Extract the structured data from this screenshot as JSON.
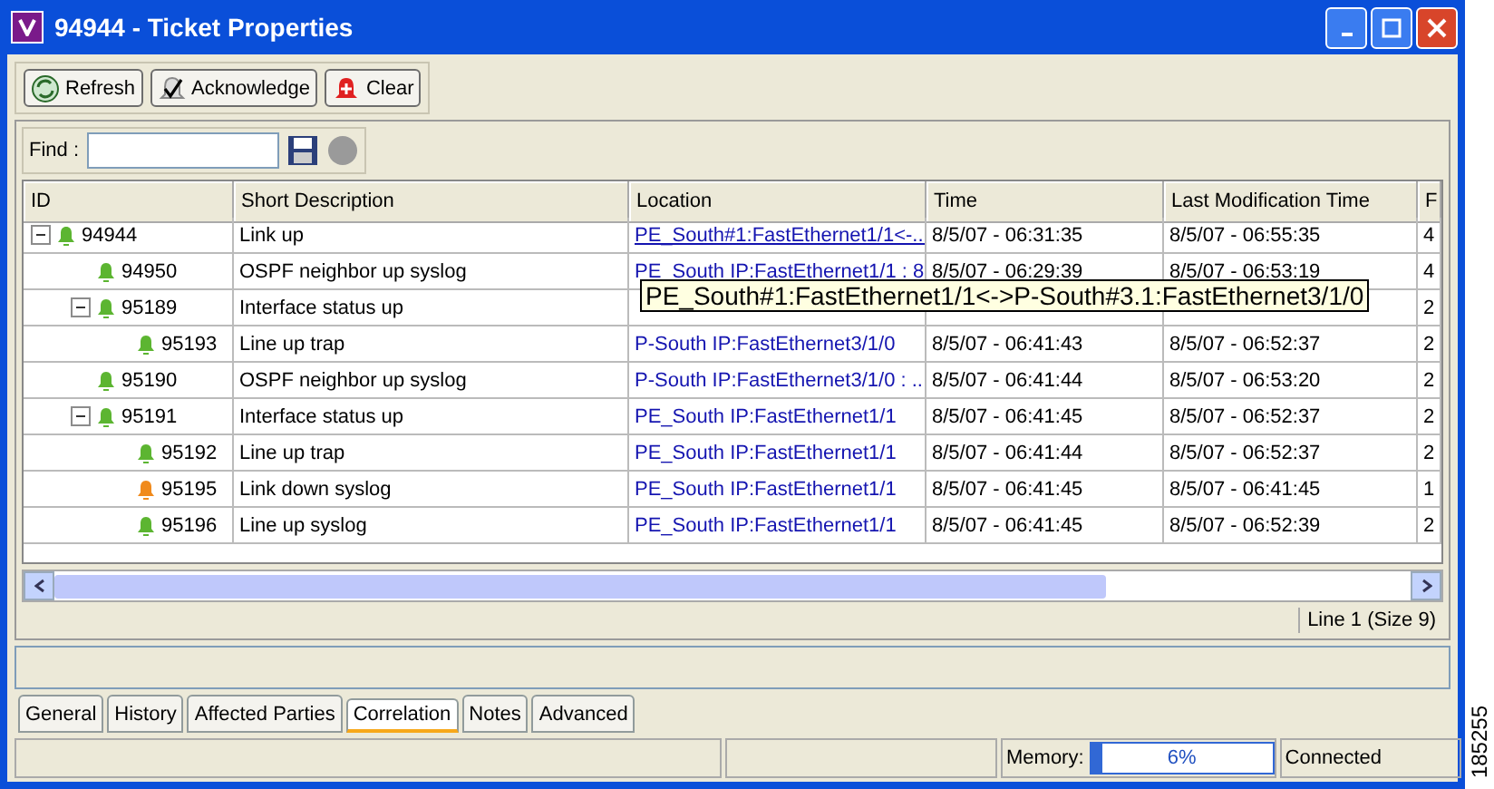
{
  "window": {
    "title": "94944 - Ticket Properties"
  },
  "toolbar": [
    {
      "label": "Refresh",
      "kind": "refresh"
    },
    {
      "label": "Acknowledge",
      "kind": "acknowledge"
    },
    {
      "label": "Clear",
      "kind": "clear"
    }
  ],
  "find": {
    "label": "Find :"
  },
  "table": {
    "columns": [
      "ID",
      "Short Description",
      "Location",
      "Time",
      "Last Modification Time",
      "F"
    ],
    "rows": [
      {
        "expanded": true,
        "color": "#5cb531",
        "cells": [
          "94944",
          "Link up",
          "PE_South#1:FastEthernet1/1<-...",
          "8/5/07 - 06:31:35",
          "8/5/07 - 06:55:35",
          "4"
        ],
        "children": [
          {
            "color": "#5cb531",
            "cells": [
              "94950",
              "OSPF neighbor up syslog",
              "PE_South IP:FastEthernet1/1 : 8",
              "8/5/07 - 06:29:39",
              "8/5/07 - 06:53:19",
              "4"
            ]
          },
          {
            "expanded": true,
            "color": "#5cb531",
            "cells": [
              "95189",
              "Interface status up",
              "",
              "",
              "",
              "2"
            ],
            "children": [
              {
                "color": "#5cb531",
                "cells": [
                  "95193",
                  "Line up trap",
                  "P-South IP:FastEthernet3/1/0",
                  "8/5/07 - 06:41:43",
                  "8/5/07 - 06:52:37",
                  "2"
                ]
              }
            ]
          },
          {
            "color": "#5cb531",
            "cells": [
              "95190",
              "OSPF neighbor up syslog",
              "P-South IP:FastEthernet3/1/0 : ...",
              "8/5/07 - 06:41:44",
              "8/5/07 - 06:53:20",
              "2"
            ]
          },
          {
            "expanded": true,
            "color": "#5cb531",
            "cells": [
              "95191",
              "Interface status up",
              "PE_South IP:FastEthernet1/1",
              "8/5/07 - 06:41:45",
              "8/5/07 - 06:52:37",
              "2"
            ],
            "children": [
              {
                "color": "#5cb531",
                "cells": [
                  "95192",
                  "Line up trap",
                  "PE_South IP:FastEthernet1/1",
                  "8/5/07 - 06:41:44",
                  "8/5/07 - 06:52:37",
                  "2"
                ]
              },
              {
                "color": "#f08a1c",
                "cells": [
                  "95195",
                  "Link down syslog",
                  "PE_South IP:FastEthernet1/1",
                  "8/5/07 - 06:41:45",
                  "8/5/07 - 06:41:45",
                  "1"
                ]
              },
              {
                "color": "#5cb531",
                "cells": [
                  "95196",
                  "Line up syslog",
                  "PE_South IP:FastEthernet1/1",
                  "8/5/07 - 06:41:45",
                  "8/5/07 - 06:52:39",
                  "2"
                ]
              }
            ]
          }
        ]
      }
    ]
  },
  "tooltip": "PE_South#1:FastEthernet1/1<->P-South#3.1:FastEthernet3/1/0",
  "line_info": "Line 1 (Size 9)",
  "tabs": [
    {
      "label": "General",
      "selected": false
    },
    {
      "label": "History",
      "selected": false
    },
    {
      "label": "Affected Parties",
      "selected": false
    },
    {
      "label": "Correlation",
      "selected": true
    },
    {
      "label": "Notes",
      "selected": false
    },
    {
      "label": "Advanced",
      "selected": false
    }
  ],
  "status_bar": {
    "memory_label": "Memory:",
    "memory": {
      "level": 0.06,
      "reading": "6%"
    },
    "connection": "Connected"
  },
  "figure_id": "185255"
}
